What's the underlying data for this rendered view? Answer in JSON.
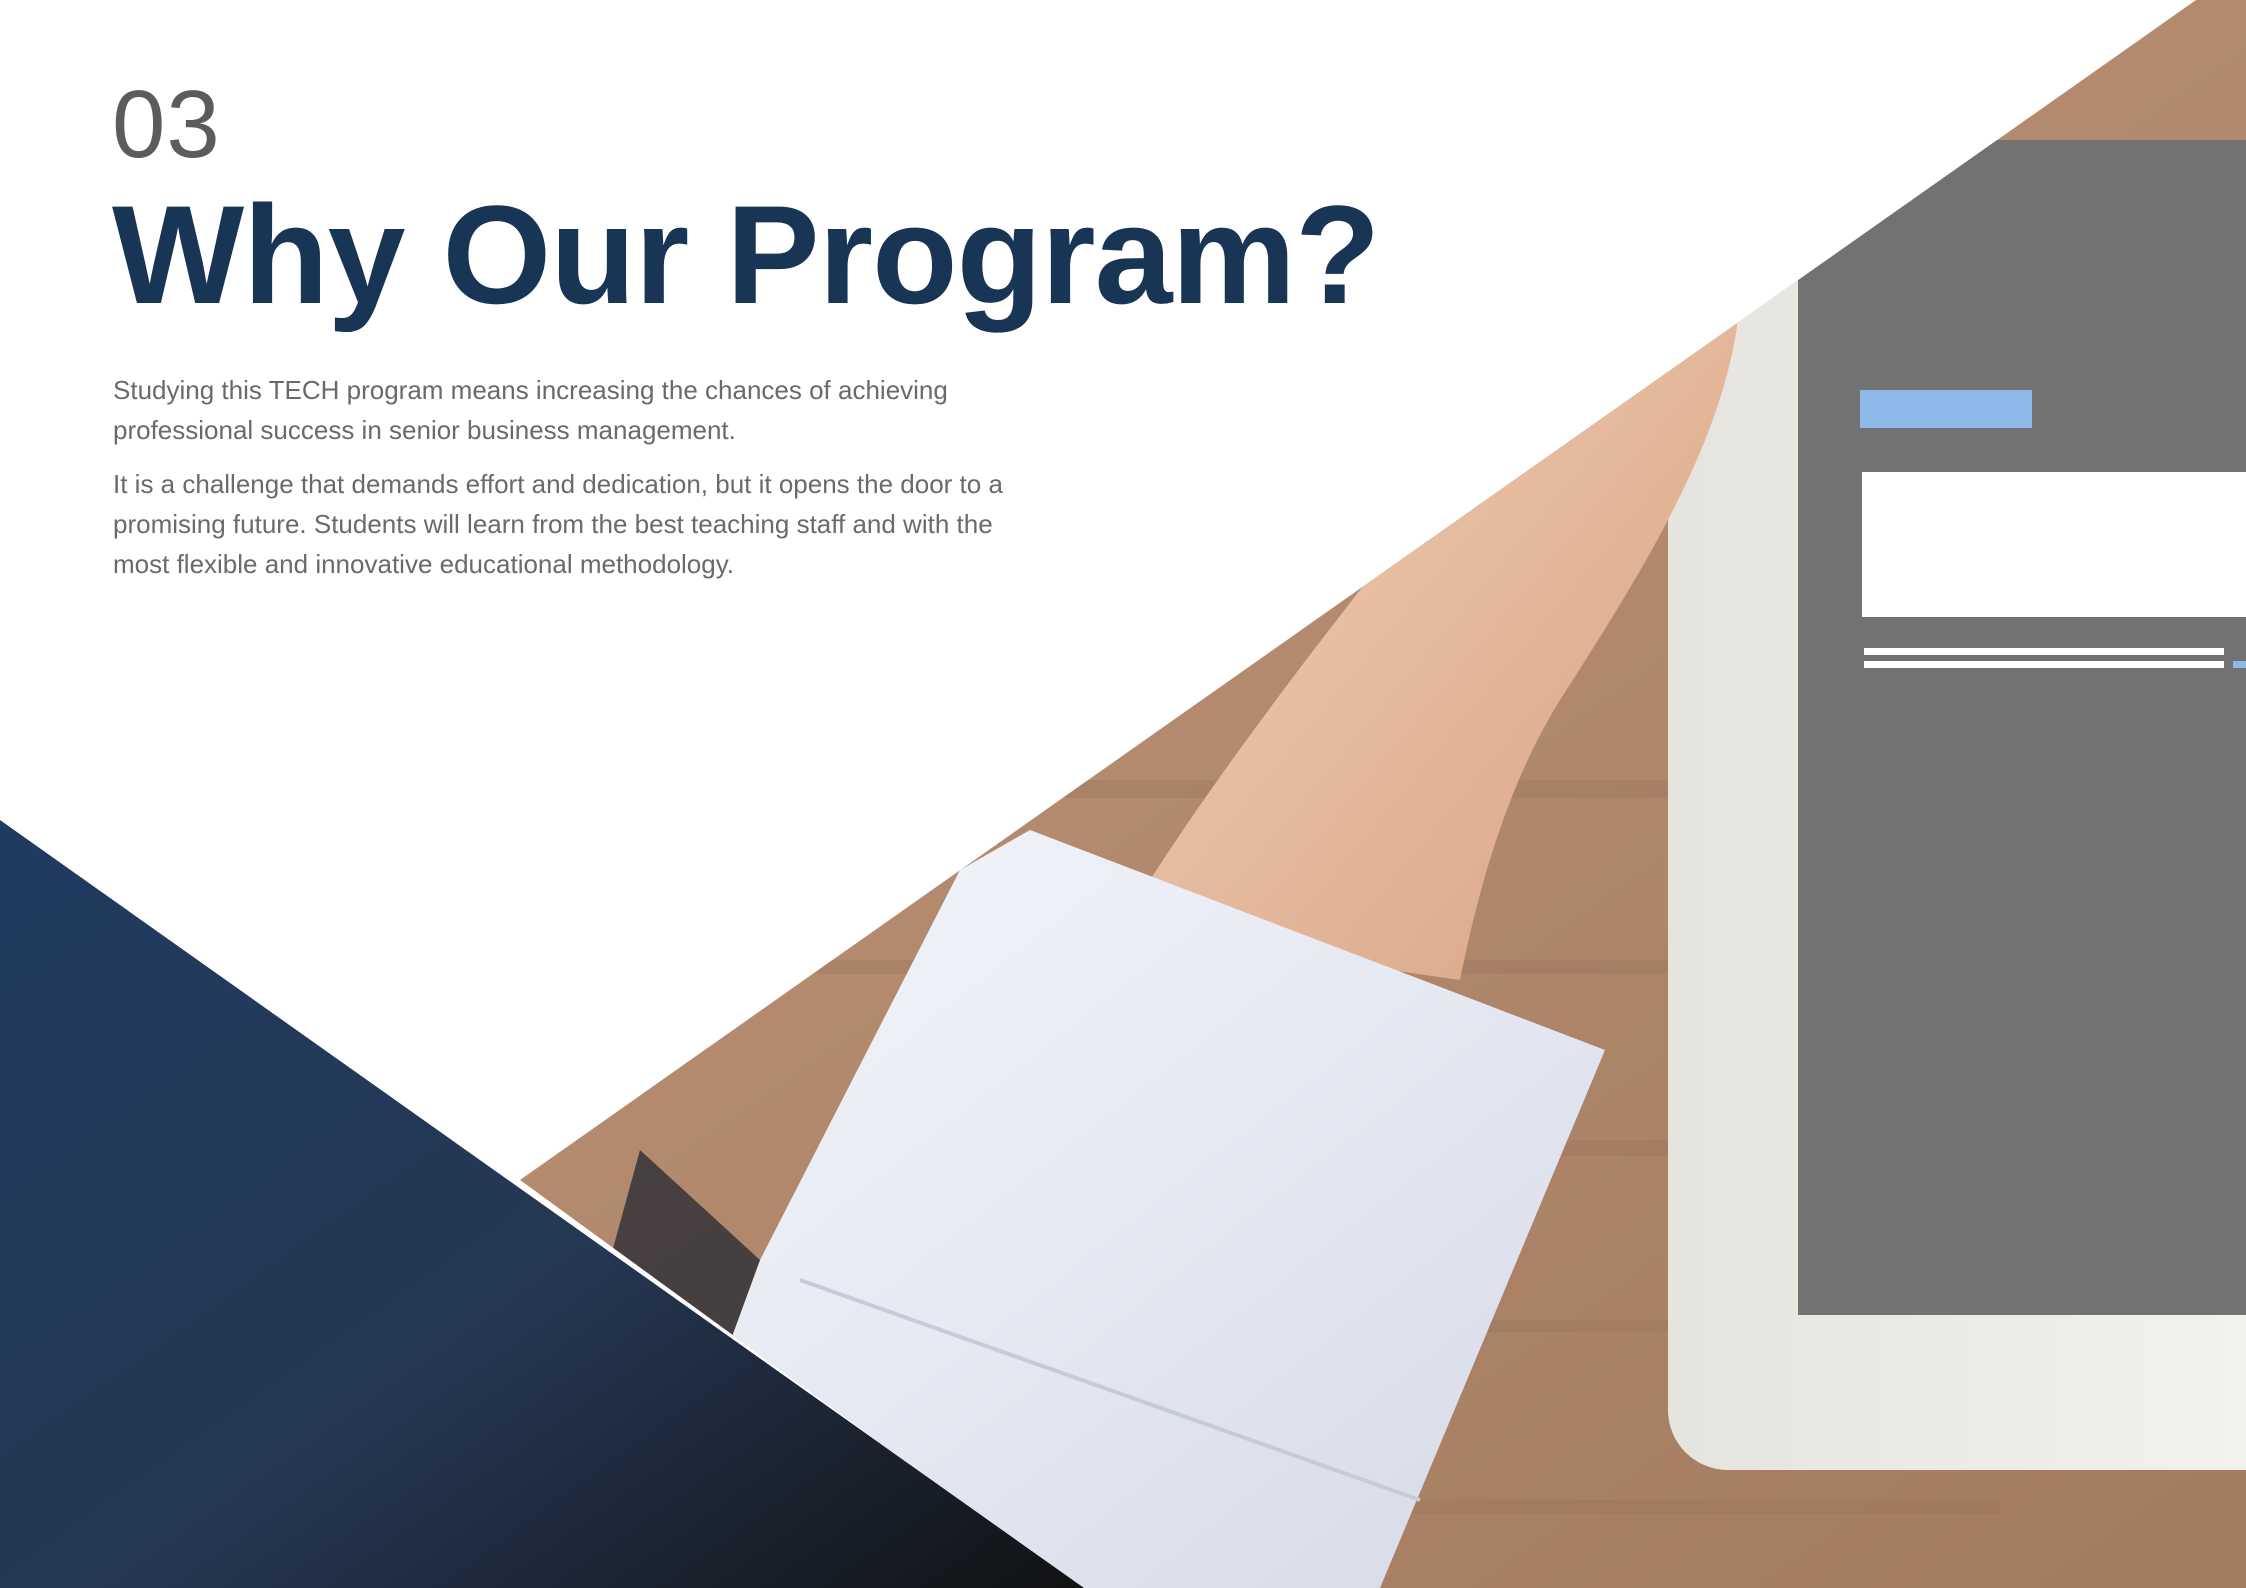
{
  "section": {
    "number": "03",
    "title": "Why Our Program?"
  },
  "body": {
    "paragraphs": [
      "Studying this TECH program means increasing the chances of achieving professional success in senior business management.",
      "It is a challenge that demands effort and dedication, but it opens the door to a promising future. Students will learn from the best teaching staff and with the most flexible and innovative educational methodology."
    ]
  },
  "colors": {
    "title": "#183556",
    "number": "#5c5c5c",
    "body_text": "#6a6a6a",
    "navy_band": "#17345a",
    "tablet_screen": "#727272",
    "screen_accent": "#8db8e8",
    "desk_wood": "#b89278"
  },
  "images": {
    "background_photo": "hand-on-tablet-photo",
    "decor": "navy-triangle"
  }
}
